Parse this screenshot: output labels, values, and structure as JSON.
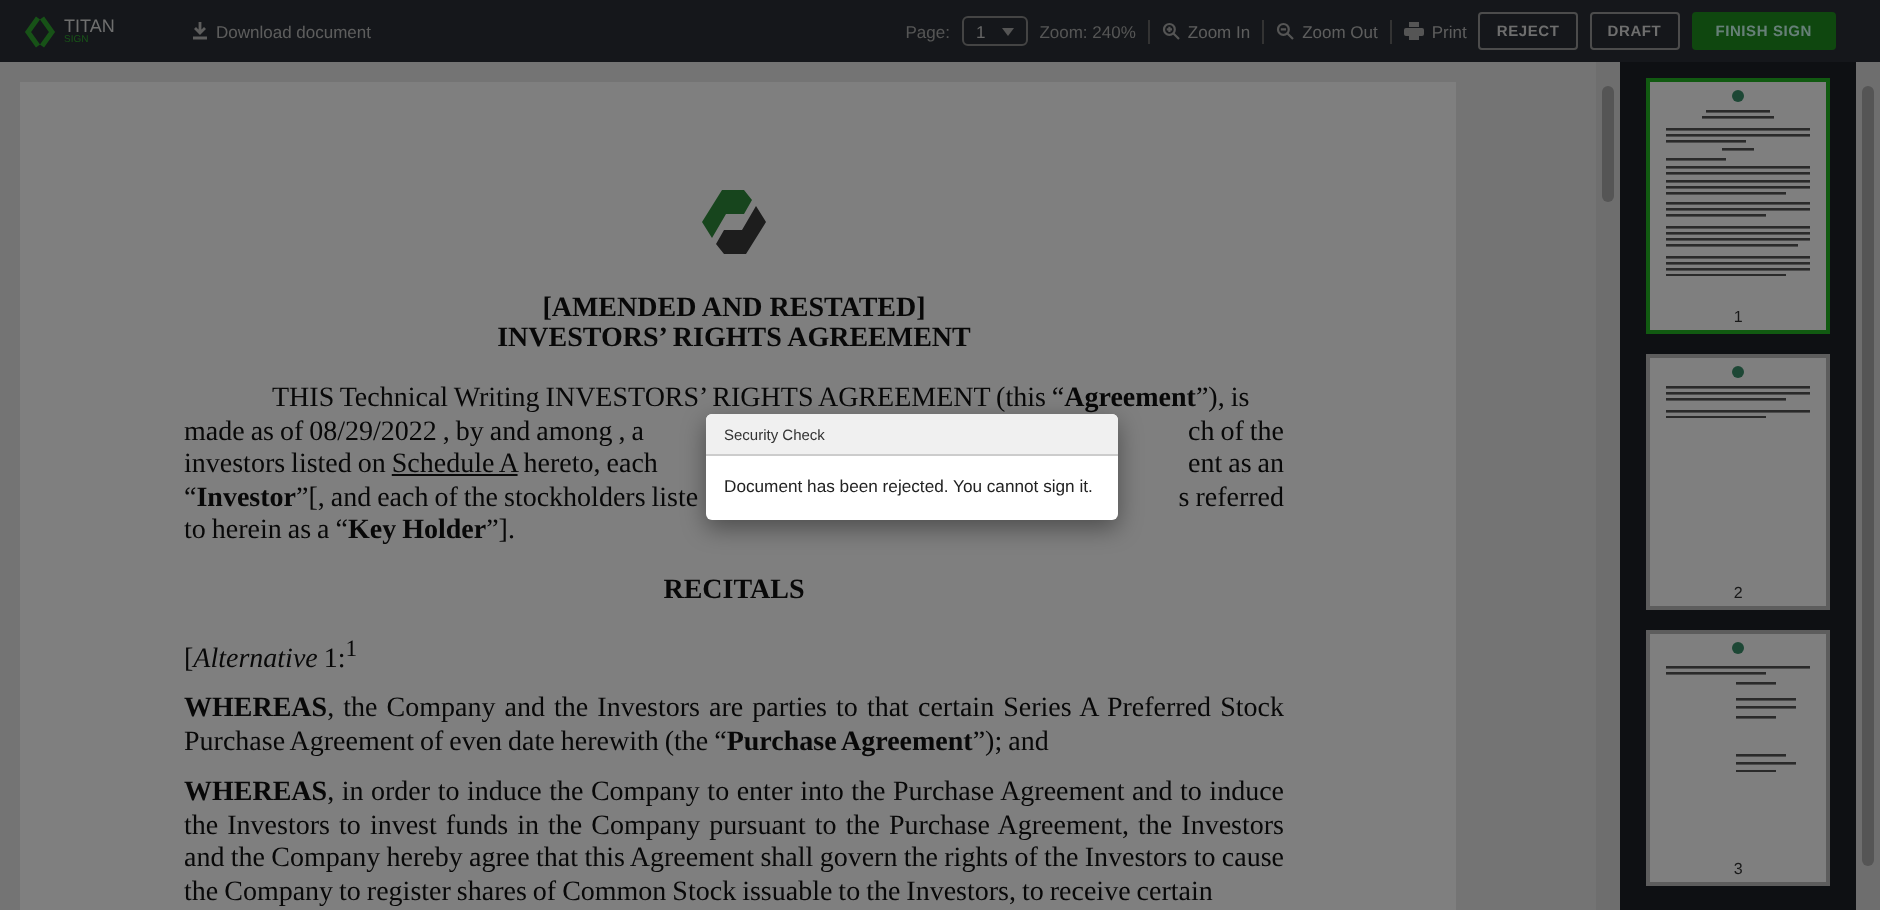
{
  "toolbar": {
    "logo": {
      "name": "TITAN",
      "tagline": "SIGN"
    },
    "download": "Download document",
    "page_label": "Page:",
    "page_select": "1",
    "zoom_label": "Zoom: 240%",
    "zoom_in": "Zoom In",
    "zoom_out": "Zoom Out",
    "print": "Print",
    "buttons": [
      {
        "label": "REJECT",
        "kind": "outline"
      },
      {
        "label": "DRAFT",
        "kind": "outline"
      },
      {
        "label": "FINISH SIGN",
        "kind": "primary"
      }
    ]
  },
  "document": {
    "blocks": [
      {
        "kind": "title",
        "lines": [
          "[AMENDED AND RESTATED]",
          "INVESTORS’ RIGHTS AGREEMENT"
        ]
      },
      {
        "kind": "split",
        "lines": [
          {
            "left": "THIS  Technical Writing INVESTORS’ RIGHTS AGREEMENT (this “**Agreement**”), is"
          },
          {
            "left": "made as of 08/29/2022 , by and among , a",
            "right": "ch of the"
          },
          {
            "left_parts": [
              {
                "text": "investors listed on "
              },
              {
                "text": "Schedule A",
                "underline": true
              },
              {
                "text": " hereto, each"
              }
            ],
            "right": "ent as an"
          },
          {
            "left": "“**Investor**”[, and each of the stockholders liste",
            "right": "s referred"
          },
          {
            "left": "to herein as a “**Key Holder**”]."
          }
        ]
      },
      {
        "kind": "heading",
        "text": "RECITALS"
      },
      {
        "kind": "paragraph",
        "text": "[*Alternative* 1:$^{1}$"
      },
      {
        "kind": "paragraph",
        "text": "**WHEREAS**, the Company and the Investors are parties to that certain Series A Preferred Stock Purchase Agreement of even date herewith (the “**Purchase Agreement**”); and"
      },
      {
        "kind": "paragraph",
        "text": "**WHEREAS**, in order to induce the Company to enter into the Purchase Agreement and to induce the Investors to invest funds in the Company pursuant to the Purchase Agreement, the Investors and the Company hereby agree that this Agreement shall govern the rights of the Investors to cause the Company to register shares of Common Stock issuable to the Investors, to receive certain"
      }
    ]
  },
  "thumbnails": [
    {
      "number": "1",
      "selected": true,
      "kind": "text"
    },
    {
      "number": "2",
      "selected": false,
      "kind": "short"
    },
    {
      "number": "3",
      "selected": false,
      "kind": "signature"
    }
  ],
  "dialog": {
    "title": "Security Check",
    "message": "Document has been rejected. You cannot sign it."
  }
}
